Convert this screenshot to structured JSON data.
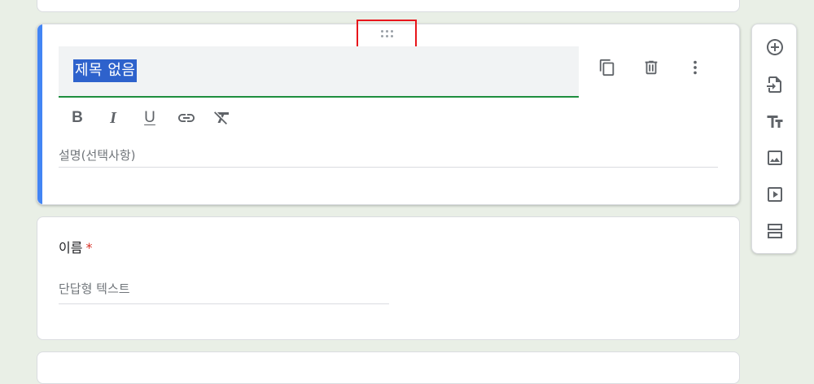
{
  "title_section": {
    "title_value": "제목 없음",
    "description_placeholder": "설명(선택사항)",
    "format_buttons": {
      "bold": "B",
      "italic": "I",
      "underline": "U"
    },
    "actions": [
      "copy-icon",
      "delete-icon",
      "more-vert-icon"
    ]
  },
  "question": {
    "label": "이름",
    "required_mark": "*",
    "answer_placeholder": "단답형 텍스트"
  },
  "side_toolbar": {
    "items": [
      "add-question-icon",
      "import-questions-icon",
      "add-title-icon",
      "add-image-icon",
      "add-video-icon",
      "add-section-icon"
    ]
  },
  "colors": {
    "accent": "#4285f4",
    "title_underline": "#1e8e3e",
    "selection": "#2e62cc",
    "required": "#d93025",
    "highlight_box": "#e8151b"
  }
}
